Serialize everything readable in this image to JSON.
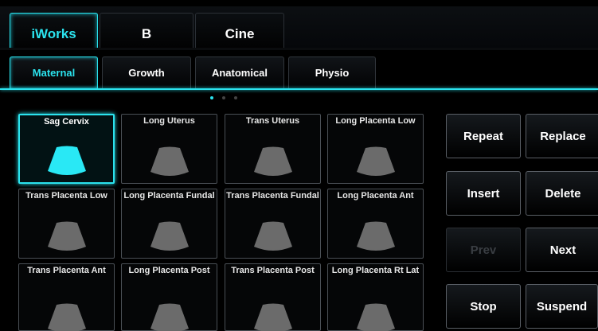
{
  "top_tabs": [
    {
      "label": "iWorks",
      "active": true
    },
    {
      "label": "B",
      "active": false
    },
    {
      "label": "Cine",
      "active": false
    }
  ],
  "sub_tabs": [
    {
      "label": "Maternal",
      "active": true
    },
    {
      "label": "Growth",
      "active": false
    },
    {
      "label": "Anatomical",
      "active": false
    },
    {
      "label": "Physio",
      "active": false
    }
  ],
  "pager": {
    "pages": 3,
    "current": 1
  },
  "protocols": [
    {
      "label": "Sag Cervix",
      "selected": true
    },
    {
      "label": "Long Uterus",
      "selected": false
    },
    {
      "label": "Trans Uterus",
      "selected": false
    },
    {
      "label": "Long Placenta Low",
      "selected": false
    },
    {
      "label": "Trans Placenta Low",
      "selected": false
    },
    {
      "label": "Long Placenta Fundal",
      "selected": false
    },
    {
      "label": "Trans Placenta Fundal",
      "selected": false
    },
    {
      "label": "Long Placenta Ant",
      "selected": false
    },
    {
      "label": "Trans Placenta Ant",
      "selected": false
    },
    {
      "label": "Long Placenta Post",
      "selected": false
    },
    {
      "label": "Trans Placenta Post",
      "selected": false
    },
    {
      "label": "Long Placenta Rt Lat",
      "selected": false
    }
  ],
  "actions": {
    "repeat": "Repeat",
    "replace": "Replace",
    "insert": "Insert",
    "delete": "Delete",
    "prev": "Prev",
    "next": "Next",
    "stop": "Stop",
    "suspend": "Suspend"
  },
  "colors": {
    "accent": "#2be3ee",
    "probe_inactive": "#6b6b6b",
    "probe_active": "#29e8f5"
  }
}
